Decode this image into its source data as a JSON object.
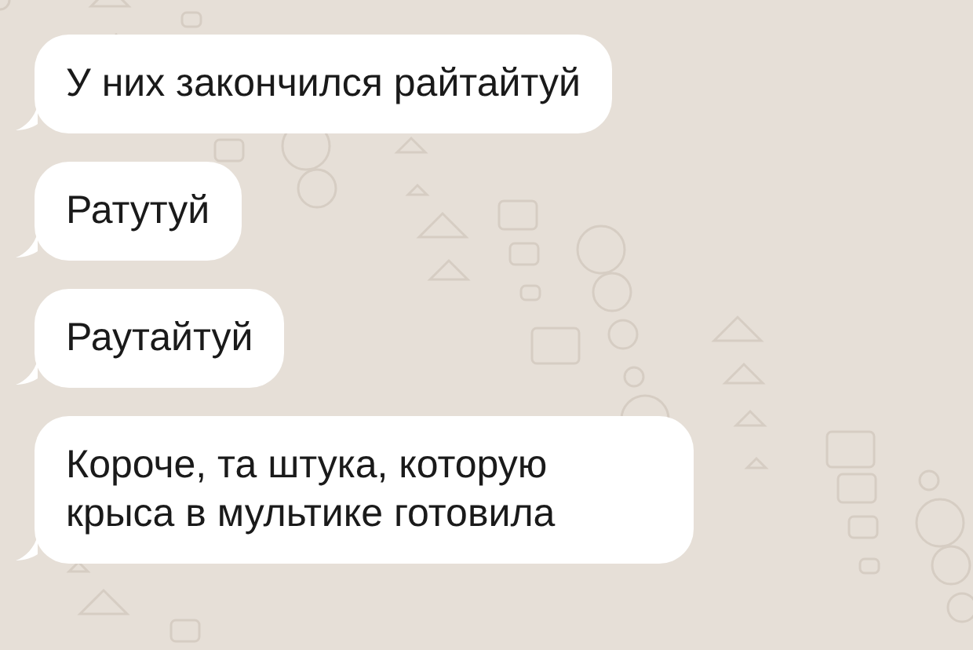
{
  "messages": [
    {
      "text": "У них закончился райтайтуй"
    },
    {
      "text": "Ратутуй"
    },
    {
      "text": "Раутайтуй"
    },
    {
      "text": "Короче, та штука, которую крыса в мультике готовила"
    }
  ]
}
